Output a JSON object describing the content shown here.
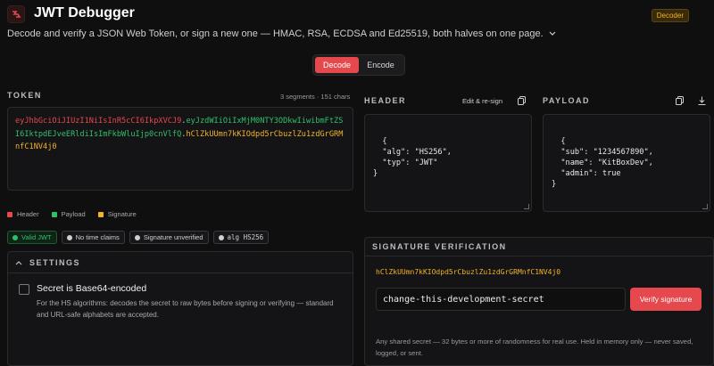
{
  "app": {
    "title": "JWT Debugger",
    "mode_badge": "Decoder",
    "subtitle": "Decode and verify a JSON Web Token, or sign a new one — HMAC, RSA, ECDSA and Ed25519, both halves on one page."
  },
  "mode_toggle": {
    "decode": "Decode",
    "encode": "Encode",
    "active": "Decode"
  },
  "token": {
    "label": "TOKEN",
    "meta": "3 segments · 151 chars",
    "header_segment": "eyJhbGciOiJIUzI1NiIsInR5cCI6IkpXVCJ9",
    "payload_segment": "eyJzdWIiOiIxMjM0NTY3ODkwIiwibmFtZSI6IktpdEJveERldiIsImFkbWluIjp0cnVlfQ",
    "signature_segment": "hClZkUUmn7kKIOdpd5rCbuzlZu1zdGrGRMnfC1NV4j0"
  },
  "legend": {
    "header": "Header",
    "payload": "Payload",
    "signature": "Signature"
  },
  "status_chips": {
    "valid": "Valid JWT",
    "time": "No time claims",
    "signature": "Signature unverified",
    "alg": "alg HS256"
  },
  "settings": {
    "label": "SETTINGS",
    "option_title": "Secret is Base64-encoded",
    "option_desc": "For the HS algorithms: decodes the secret to raw bytes before signing or verifying — standard and URL-safe alphabets are accepted."
  },
  "header_panel": {
    "label": "HEADER",
    "action": "Edit & re-sign",
    "json": "{\n  \"alg\": \"HS256\",\n  \"typ\": \"JWT\"\n}"
  },
  "payload_panel": {
    "label": "PAYLOAD",
    "json": "{\n  \"sub\": \"1234567890\",\n  \"name\": \"KitBoxDev\",\n  \"admin\": true\n}"
  },
  "signature_verification": {
    "label": "SIGNATURE VERIFICATION",
    "signature": "hClZkUUmn7kKIOdpd5rCbuzlZu1zdGrGRMnfC1NV4j0",
    "secret_value": "change-this-development-secret",
    "verify_button": "Verify signature",
    "note": "Any shared secret — 32 bytes or more of randomness for real use. Held in memory only — never saved, logged, or sent."
  },
  "colors": {
    "accent": "#e5484d",
    "header_segment": "#e5484d",
    "payload_segment": "#30c06a",
    "signature_segment": "#f0b429"
  }
}
